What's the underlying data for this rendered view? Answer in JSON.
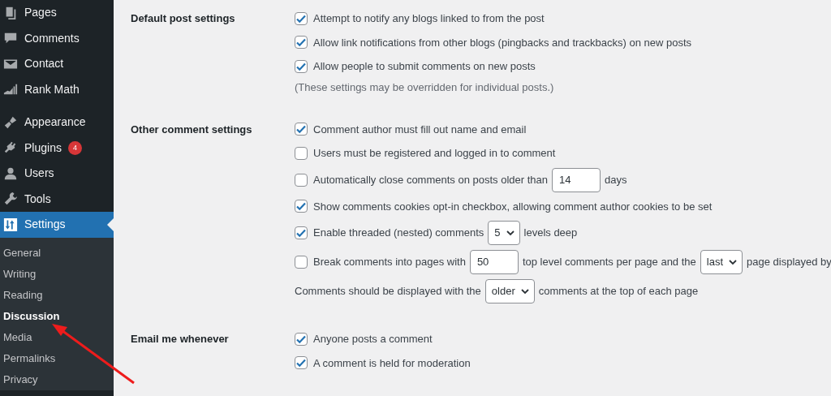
{
  "sidebar": {
    "menu_groups": [
      [
        {
          "label": "Pages",
          "selected": false
        },
        {
          "label": "Comments",
          "selected": false
        },
        {
          "label": "Contact",
          "selected": false
        },
        {
          "label": "Rank Math",
          "selected": false
        }
      ],
      [
        {
          "label": "Appearance",
          "selected": false
        },
        {
          "label": "Plugins",
          "badge": "4",
          "selected": false
        },
        {
          "label": "Users",
          "selected": false
        },
        {
          "label": "Tools",
          "selected": false
        },
        {
          "label": "Settings",
          "selected": true
        }
      ]
    ],
    "submenu": [
      {
        "label": "General",
        "selected": false
      },
      {
        "label": "Writing",
        "selected": false
      },
      {
        "label": "Reading",
        "selected": false
      },
      {
        "label": "Discussion",
        "selected": true
      },
      {
        "label": "Media",
        "selected": false
      },
      {
        "label": "Permalinks",
        "selected": false
      },
      {
        "label": "Privacy",
        "selected": false
      }
    ]
  },
  "sections": [
    {
      "label": "Default post settings",
      "rows": [
        {
          "kind": "checkbox",
          "checked": true,
          "parts": [
            {
              "kind": "text",
              "text": "Attempt to notify any blogs linked to from the post"
            }
          ]
        },
        {
          "kind": "checkbox",
          "checked": true,
          "parts": [
            {
              "kind": "text",
              "text": "Allow link notifications from other blogs (pingbacks and trackbacks) on new posts"
            }
          ]
        },
        {
          "kind": "checkbox",
          "checked": true,
          "parts": [
            {
              "kind": "text",
              "text": "Allow people to submit comments on new posts"
            }
          ]
        },
        {
          "kind": "note",
          "parts": [
            {
              "kind": "text",
              "text": "(These settings may be overridden for individual posts.)"
            }
          ]
        }
      ]
    },
    {
      "label": "Other comment settings",
      "rows": [
        {
          "kind": "checkbox",
          "checked": true,
          "parts": [
            {
              "kind": "text",
              "text": "Comment author must fill out name and email"
            }
          ]
        },
        {
          "kind": "checkbox",
          "checked": false,
          "parts": [
            {
              "kind": "text",
              "text": "Users must be registered and logged in to comment"
            }
          ]
        },
        {
          "kind": "checkbox",
          "checked": false,
          "parts": [
            {
              "kind": "text",
              "text": "Automatically close comments on posts older than"
            },
            {
              "kind": "input",
              "value": "14"
            },
            {
              "kind": "text",
              "text": "days"
            }
          ]
        },
        {
          "kind": "checkbox",
          "checked": true,
          "parts": [
            {
              "kind": "text",
              "text": "Show comments cookies opt-in checkbox, allowing comment author cookies to be set"
            }
          ]
        },
        {
          "kind": "checkbox",
          "checked": true,
          "parts": [
            {
              "kind": "text",
              "text": "Enable threaded (nested) comments"
            },
            {
              "kind": "select",
              "value": "5"
            },
            {
              "kind": "text",
              "text": "levels deep"
            }
          ]
        },
        {
          "kind": "checkbox",
          "checked": false,
          "parts": [
            {
              "kind": "text",
              "text": "Break comments into pages with"
            },
            {
              "kind": "input",
              "value": "50"
            },
            {
              "kind": "text",
              "text": "top level comments per page and the"
            },
            {
              "kind": "select",
              "value": "last"
            },
            {
              "kind": "text",
              "text": "page displayed by"
            }
          ]
        },
        {
          "kind": "plain",
          "parts": [
            {
              "kind": "text",
              "text": "Comments should be displayed with the"
            },
            {
              "kind": "select",
              "value": "older"
            },
            {
              "kind": "text",
              "text": "comments at the top of each page"
            }
          ]
        }
      ]
    },
    {
      "label": "Email me whenever",
      "rows": [
        {
          "kind": "checkbox",
          "checked": true,
          "parts": [
            {
              "kind": "text",
              "text": "Anyone posts a comment"
            }
          ]
        },
        {
          "kind": "checkbox",
          "checked": true,
          "parts": [
            {
              "kind": "text",
              "text": "A comment is held for moderation"
            }
          ]
        }
      ]
    }
  ]
}
